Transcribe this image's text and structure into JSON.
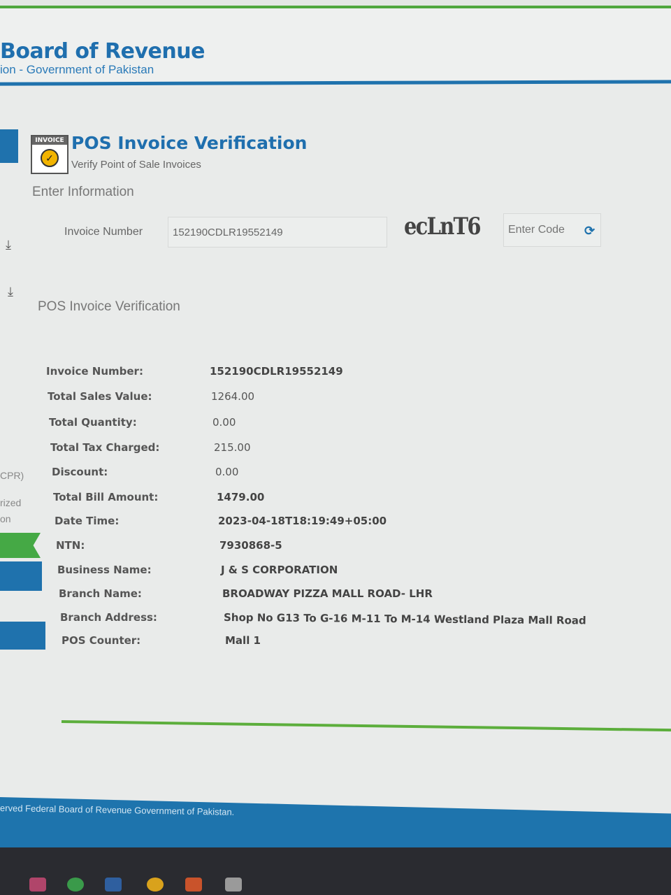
{
  "header": {
    "title": "Board of Revenue",
    "subtitle": "ion - Government of Pakistan"
  },
  "sidebar": {
    "partial_labels": [
      "CPR)",
      "rized",
      "on"
    ],
    "download_icon": "download-icon"
  },
  "form": {
    "icon_tag": "INVOICE",
    "title": "POS Invoice Verification",
    "subtitle": "Verify Point of Sale Invoices",
    "section_label": "Enter Information",
    "invoice_label": "Invoice Number",
    "invoice_value": "152190CDLR19552149",
    "captcha": "ecLnT6",
    "code_placeholder": "Enter Code",
    "refresh_icon": "refresh-icon"
  },
  "result": {
    "title": "POS Invoice Verification",
    "rows": [
      {
        "label": "Invoice Number:",
        "value": "152190CDLR19552149"
      },
      {
        "label": "Total Sales Value:",
        "value": "1264.00"
      },
      {
        "label": "Total Quantity:",
        "value": "0.00"
      },
      {
        "label": "Total Tax Charged:",
        "value": "215.00"
      },
      {
        "label": "Discount:",
        "value": "0.00"
      },
      {
        "label": "Total Bill Amount:",
        "value": "1479.00"
      },
      {
        "label": "Date Time:",
        "value": "2023-04-18T18:19:49+05:00"
      },
      {
        "label": "NTN:",
        "value": "7930868-5"
      },
      {
        "label": "Business Name:",
        "value": "J & S CORPORATION"
      },
      {
        "label": "Branch Name:",
        "value": "BROADWAY PIZZA MALL ROAD- LHR"
      },
      {
        "label": "Branch Address:",
        "value": "Shop No G13 To G-16 M-11 To M-14 Westland Plaza Mall Road"
      },
      {
        "label": "POS Counter:",
        "value": "Mall 1"
      }
    ]
  },
  "footer": {
    "text": "erved Federal Board of Revenue Government of Pakistan."
  },
  "colors": {
    "brand_blue": "#1f72ad",
    "accent_green": "#4fa83d"
  }
}
